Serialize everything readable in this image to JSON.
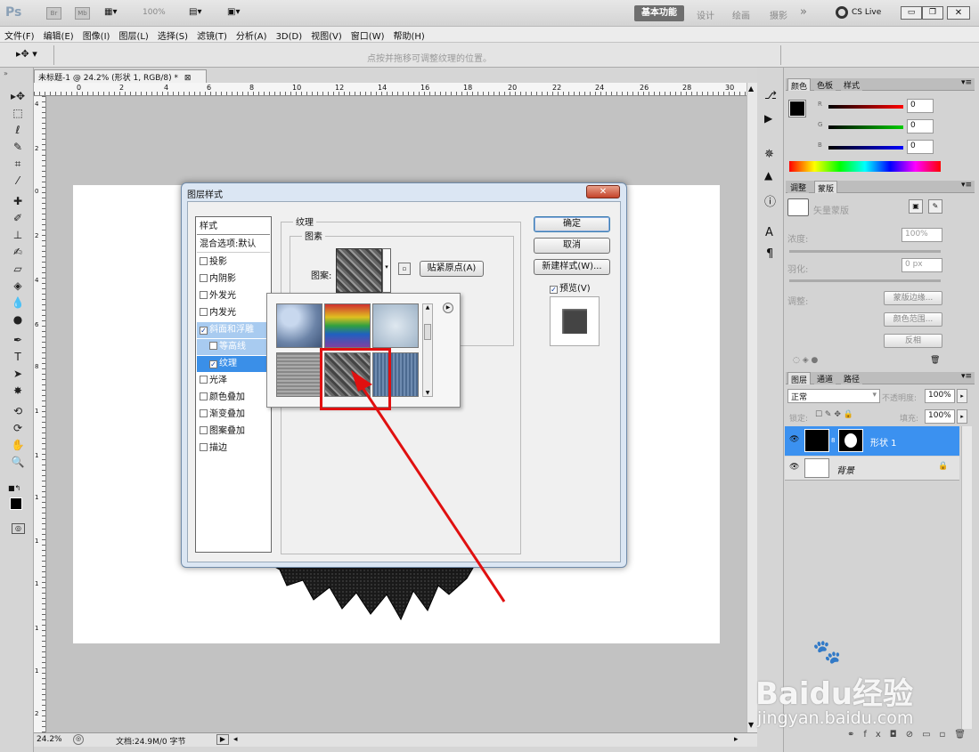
{
  "app": {
    "logo": "Ps",
    "workspace_active": "基本功能",
    "workspaces": [
      "设计",
      "绘画",
      "摄影"
    ],
    "more": "»",
    "cslive": "CS Live",
    "zoom_display": "100%"
  },
  "menu": [
    "文件(F)",
    "编辑(E)",
    "图像(I)",
    "图层(L)",
    "选择(S)",
    "滤镜(T)",
    "分析(A)",
    "3D(D)",
    "视图(V)",
    "窗口(W)",
    "帮助(H)"
  ],
  "options": {
    "hint": "点按并拖移可调整纹理的位置。"
  },
  "document": {
    "tab_title": "未标题-1 @ 24.2% (形状 1, RGB/8) *",
    "close": "⊠",
    "ruler_top": [
      "0",
      "2",
      "4",
      "6",
      "8",
      "10",
      "12",
      "14",
      "16",
      "18",
      "20",
      "22",
      "24",
      "26",
      "28",
      "30"
    ],
    "ruler_left": [
      "4",
      "2",
      "0",
      "2",
      "4",
      "6",
      "8",
      "1",
      "1",
      "1",
      "1",
      "1",
      "1",
      "1",
      "2",
      "2",
      "2"
    ]
  },
  "status": {
    "zoom": "24.2%",
    "doc": "文档:24.9M/0 字节"
  },
  "dialog": {
    "title": "图层样式",
    "style_header": "样式",
    "blend": "混合选项:默认",
    "styles": [
      {
        "label": "投影",
        "checked": false
      },
      {
        "label": "内阴影",
        "checked": false
      },
      {
        "label": "外发光",
        "checked": false
      },
      {
        "label": "内发光",
        "checked": false
      },
      {
        "label": "斜面和浮雕",
        "checked": true,
        "active": true
      },
      {
        "label": "等高线",
        "checked": false,
        "sub": true,
        "active": true
      },
      {
        "label": "纹理",
        "checked": true,
        "sub": true,
        "selected": true
      },
      {
        "label": "光泽",
        "checked": false
      },
      {
        "label": "颜色叠加",
        "checked": false
      },
      {
        "label": "渐变叠加",
        "checked": false
      },
      {
        "label": "图案叠加",
        "checked": false
      },
      {
        "label": "描边",
        "checked": false
      }
    ],
    "section": "纹理",
    "subsection": "图素",
    "pattern_label": "图案:",
    "snap_button": "贴紧原点(A)",
    "ok": "确定",
    "cancel": "取消",
    "new_style": "新建样式(W)...",
    "preview": "预览(V)",
    "preview_checked": true,
    "close": "✕"
  },
  "panels": {
    "color": {
      "tabs": [
        "颜色",
        "色板",
        "样式"
      ],
      "channels": [
        {
          "label": "R",
          "value": "0"
        },
        {
          "label": "G",
          "value": "0"
        },
        {
          "label": "B",
          "value": "0"
        }
      ]
    },
    "masks": {
      "tabs": [
        "调整",
        "蒙版"
      ],
      "no_mask": "矢量蒙版",
      "density_label": "浓度:",
      "density": "100%",
      "feather_label": "羽化:",
      "feather": "0 px",
      "refine_label": "调整:",
      "buttons": [
        "蒙版边缘...",
        "颜色范围...",
        "反相"
      ]
    },
    "layers": {
      "tabs": [
        "图层",
        "通道",
        "路径"
      ],
      "blend": "正常",
      "opacity_label": "不透明度:",
      "opacity": "100%",
      "lock_label": "锁定:",
      "fill_label": "填充:",
      "fill": "100%",
      "items": [
        {
          "name": "形状 1",
          "selected": true
        },
        {
          "name": "背景",
          "locked": true
        }
      ]
    }
  },
  "watermark": {
    "brand": "Baidu经验",
    "url": "jingyan.baidu.com"
  }
}
